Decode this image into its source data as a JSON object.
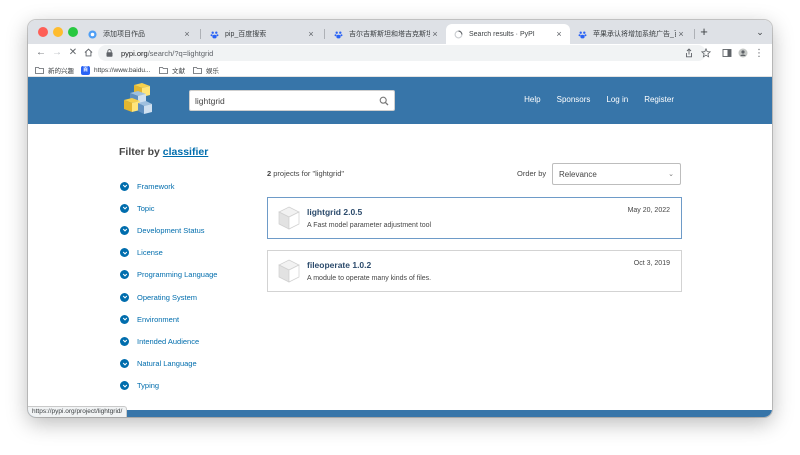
{
  "browser": {
    "tabs": [
      {
        "title": "添加项目作品",
        "active": false
      },
      {
        "title": "pip_百度搜索",
        "active": false
      },
      {
        "title": "吉尔吉斯斯坦和塔吉克斯坦边境冲",
        "active": false
      },
      {
        "title": "Search results · PyPI",
        "active": true
      },
      {
        "title": "苹果承认将增加系统广告_百度搜",
        "active": false
      }
    ],
    "close_glyph": "×",
    "new_tab_glyph": "+",
    "tab_menu_glyph": "⌄",
    "url_host": "pypi.org",
    "url_path": "/search/?q=lightgrid",
    "bookmarks": [
      {
        "label": "新的兴趣",
        "icon": "folder-icon"
      },
      {
        "label": "https://www.baidu...",
        "icon": "baidu-icon"
      },
      {
        "label": "文献",
        "icon": "folder-icon"
      },
      {
        "label": "娱乐",
        "icon": "folder-icon"
      }
    ],
    "baidu_badge": "百",
    "status_url": "https://pypi.org/project/lightgrid/"
  },
  "pypi": {
    "search_value": "lightgrid",
    "nav": [
      "Help",
      "Sponsors",
      "Log in",
      "Register"
    ],
    "filter_prefix": "Filter by",
    "filter_link": "classifier",
    "facets": [
      "Framework",
      "Topic",
      "Development Status",
      "License",
      "Programming Language",
      "Operating System",
      "Environment",
      "Intended Audience",
      "Natural Language",
      "Typing"
    ],
    "result_count": "2",
    "result_query_text": "projects for \"lightgrid\"",
    "order_by_label": "Order by",
    "order_by_value": "Relevance",
    "results": [
      {
        "name": "lightgrid 2.0.5",
        "description": "A Fast model parameter adjustment tool",
        "date": "May 20, 2022"
      },
      {
        "name": "fileoperate 1.0.2",
        "description": "A module to operate many kinds of files.",
        "date": "Oct 3, 2019"
      }
    ]
  },
  "colors": {
    "pypi_blue": "#3775a9",
    "link_blue": "#006dad",
    "chrome_tabstrip": "#dee1e6"
  }
}
